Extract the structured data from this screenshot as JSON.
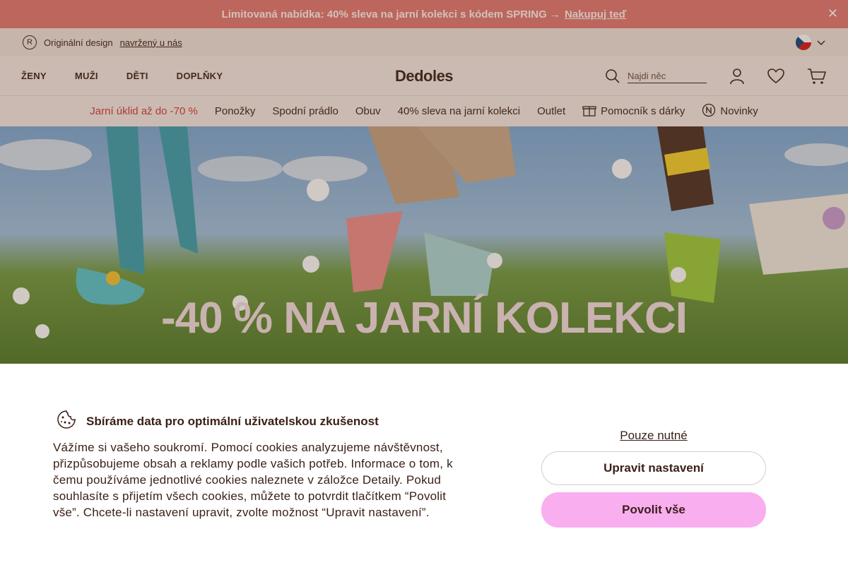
{
  "promo": {
    "text": "Limitovaná nabídka: 40% sleva na jarní kolekci s kódem SPRING →",
    "link": "Nakupuj teď"
  },
  "info_bar": {
    "text": "Originální design",
    "link": "navržený u nás"
  },
  "header": {
    "nav": [
      "ŽENY",
      "MUŽI",
      "DĚTI",
      "DOPLŇKY"
    ],
    "logo": "Dedoles",
    "search_placeholder": "Najdi něc"
  },
  "categories": {
    "sale": "Jarní úklid až do -70 %",
    "items": [
      "Ponožky",
      "Spodní prádlo",
      "Obuv",
      "40% sleva na jarní kolekci",
      "Outlet"
    ],
    "gift_helper": "Pomocník s dárky",
    "news": "Novinky"
  },
  "hero": {
    "title": "-40 % NA JARNÍ KOLEKCI"
  },
  "cookie": {
    "title": "Sbíráme data pro optimální uživatelskou zkušenost",
    "text": "Vážíme si vašeho soukromí. Pomocí cookies analyzujeme návštěvnost, přizpůsobujeme obsah a reklamy podle vašich potřeb. Informace o tom, k čemu používáme jednotlivé cookies naleznete v záložce Detaily. Pokud souhlasíte s přijetím všech cookies, můžete to potvrdit tlačítkem “Povolit vše”. Chcete-li nastavení upravit, zvolte možnost “Upravit nastavení”.",
    "only_necessary": "Pouze nutné",
    "edit_settings": "Upravit nastavení",
    "allow_all": "Povolit vše"
  },
  "colors": {
    "promo_bg": "#e27772",
    "accent_pink": "#f9aef0",
    "sale_red": "#d23a3a"
  }
}
